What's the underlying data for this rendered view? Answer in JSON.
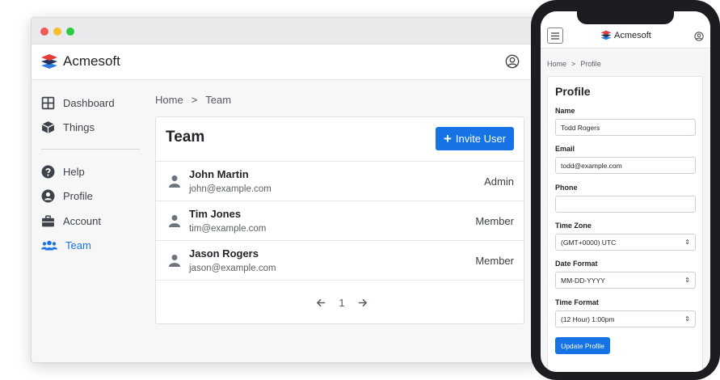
{
  "colors": {
    "accent": "#1673e6",
    "logo_red": "#e23d3d",
    "logo_navy": "#22305a",
    "logo_blue": "#2d7be0"
  },
  "desktop": {
    "brand": "Acmesoft",
    "sidebar": {
      "items": [
        {
          "label": "Dashboard",
          "icon": "dashboard-icon"
        },
        {
          "label": "Things",
          "icon": "box-icon"
        },
        {
          "label": "Help",
          "icon": "help-icon"
        },
        {
          "label": "Profile",
          "icon": "profile-icon"
        },
        {
          "label": "Account",
          "icon": "briefcase-icon"
        },
        {
          "label": "Team",
          "icon": "team-icon",
          "active": true
        }
      ]
    },
    "breadcrumb": {
      "home": "Home",
      "separator": ">",
      "current": "Team"
    },
    "team_card": {
      "title": "Team",
      "invite_button": "Invite User",
      "rows": [
        {
          "name": "John Martin",
          "email": "john@example.com",
          "role": "Admin"
        },
        {
          "name": "Tim Jones",
          "email": "tim@example.com",
          "role": "Member"
        },
        {
          "name": "Jason Rogers",
          "email": "jason@example.com",
          "role": "Member"
        }
      ],
      "pagination": {
        "page": "1"
      }
    }
  },
  "phone": {
    "brand": "Acmesoft",
    "breadcrumb": {
      "home": "Home",
      "separator": ">",
      "current": "Profile"
    },
    "profile_form": {
      "title": "Profile",
      "fields": [
        {
          "label": "Name",
          "value": "Todd Rogers"
        },
        {
          "label": "Email",
          "value": "todd@example.com"
        },
        {
          "label": "Phone",
          "value": ""
        },
        {
          "label": "Time Zone",
          "value": "(GMT+0000) UTC"
        },
        {
          "label": "Date Format",
          "value": "MM-DD-YYYY"
        },
        {
          "label": "Time Format",
          "value": "(12 Hour) 1:00pm"
        }
      ],
      "update_button": "Update Profile"
    }
  }
}
